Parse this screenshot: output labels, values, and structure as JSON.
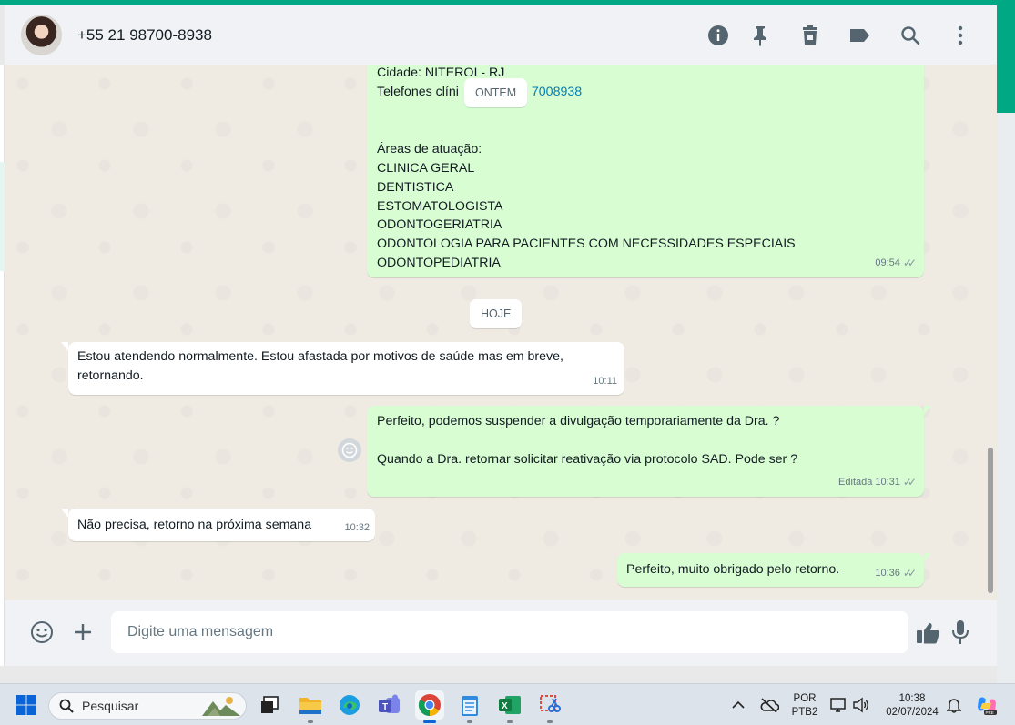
{
  "header": {
    "contact_name": "+55 21 98700-8938",
    "icons": [
      "info-icon",
      "pin-icon",
      "delete-icon",
      "label-icon",
      "search-icon",
      "menu-icon"
    ]
  },
  "messages": {
    "partial_lines": {
      "city": "Cidade: NITEROI - RJ",
      "phones_prefix": "Telefones clíni",
      "phones_link": "7008938"
    },
    "date_chip_yesterday": "ONTEM",
    "areas_title": "Áreas de atuação:",
    "areas": [
      "CLINICA GERAL",
      "DENTISTICA",
      "ESTOMATOLOGISTA",
      "ODONTOGERIATRIA",
      "ODONTOLOGIA PARA PACIENTES COM NECESSIDADES ESPECIAIS",
      "ODONTOPEDIATRIA"
    ],
    "areas_time": "09:54",
    "date_chip_today": "HOJE",
    "m1_text": "Estou atendendo normalmente. Estou afastada por motivos de saúde mas em breve, retornando.",
    "m1_time": "10:11",
    "m2_line1": "Perfeito, podemos suspender a divulgação temporariamente da Dra. ?",
    "m2_line2": "Quando a Dra. retornar solicitar reativação via protocolo SAD. Pode ser ?",
    "m2_edited": "Editada",
    "m2_time": "10:31",
    "m3_text": "Não precisa,  retorno na próxima semana",
    "m3_time": "10:32",
    "m4_text": "Perfeito, muito obrigado pelo retorno.",
    "m4_time": "10:36"
  },
  "composer": {
    "placeholder": "Digite uma mensagem"
  },
  "taskbar": {
    "search_placeholder": "Pesquisar",
    "lang_line1": "POR",
    "lang_line2": "PTB2",
    "time": "10:38",
    "date": "02/07/2024"
  },
  "colors": {
    "accent": "#00a884",
    "outgoing_bubble": "#d9fdd3",
    "incoming_bubble": "#ffffff",
    "chat_bg": "#efeae2",
    "link": "#027eb5"
  }
}
